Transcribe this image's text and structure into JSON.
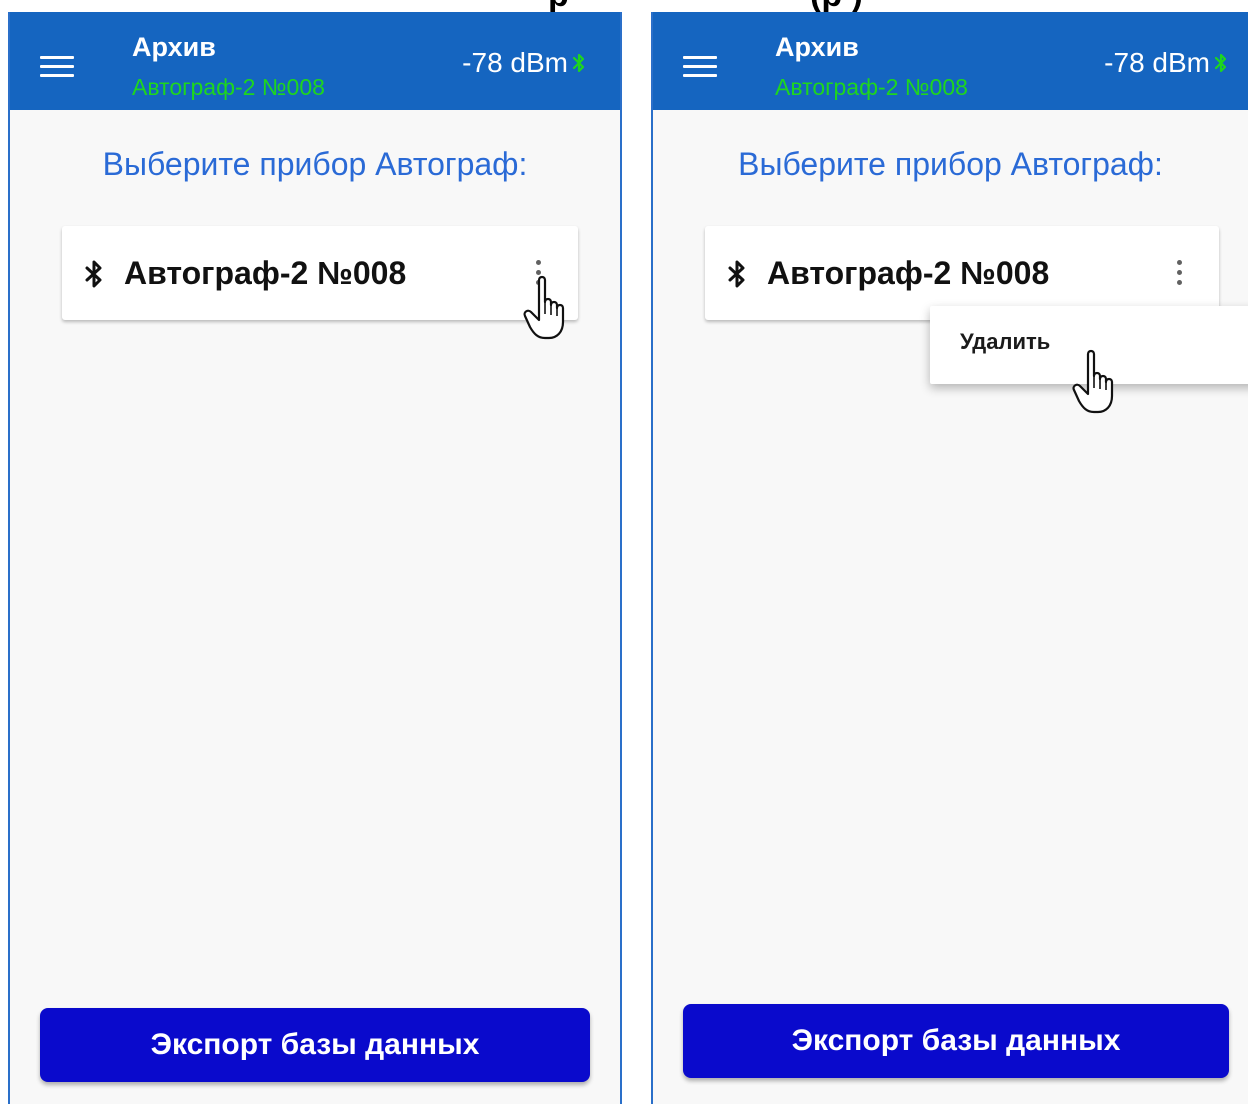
{
  "top_caption": {
    "left_fragment": "р",
    "right_fragment": "(р     )"
  },
  "screens": [
    {
      "app_bar": {
        "title": "Архив",
        "subtitle": "Автограф-2 №008",
        "signal": "-78 dBm"
      },
      "prompt": "Выберите прибор Автограф:",
      "device": {
        "name": "Автограф-2 №008"
      },
      "export_label": "Экспорт базы данных"
    },
    {
      "app_bar": {
        "title": "Архив",
        "subtitle": "Автограф-2 №008",
        "signal": "-78 dBm"
      },
      "prompt": "Выберите прибор Автограф:",
      "device": {
        "name": "Автограф-2 №008"
      },
      "context_menu": {
        "delete_label": "Удалить"
      },
      "export_label": "Экспорт базы данных"
    }
  ],
  "colors": {
    "app_bar": "#1565c0",
    "subtitle_green": "#1ed61e",
    "prompt_blue": "#2a6ad6",
    "export_button": "#0a0acc",
    "frame_border": "#2a6fc9"
  },
  "icons": {
    "menu": "hamburger-menu-icon",
    "bluetooth": "bluetooth-icon",
    "more": "more-vertical-icon",
    "cursor": "hand-pointer-icon"
  }
}
